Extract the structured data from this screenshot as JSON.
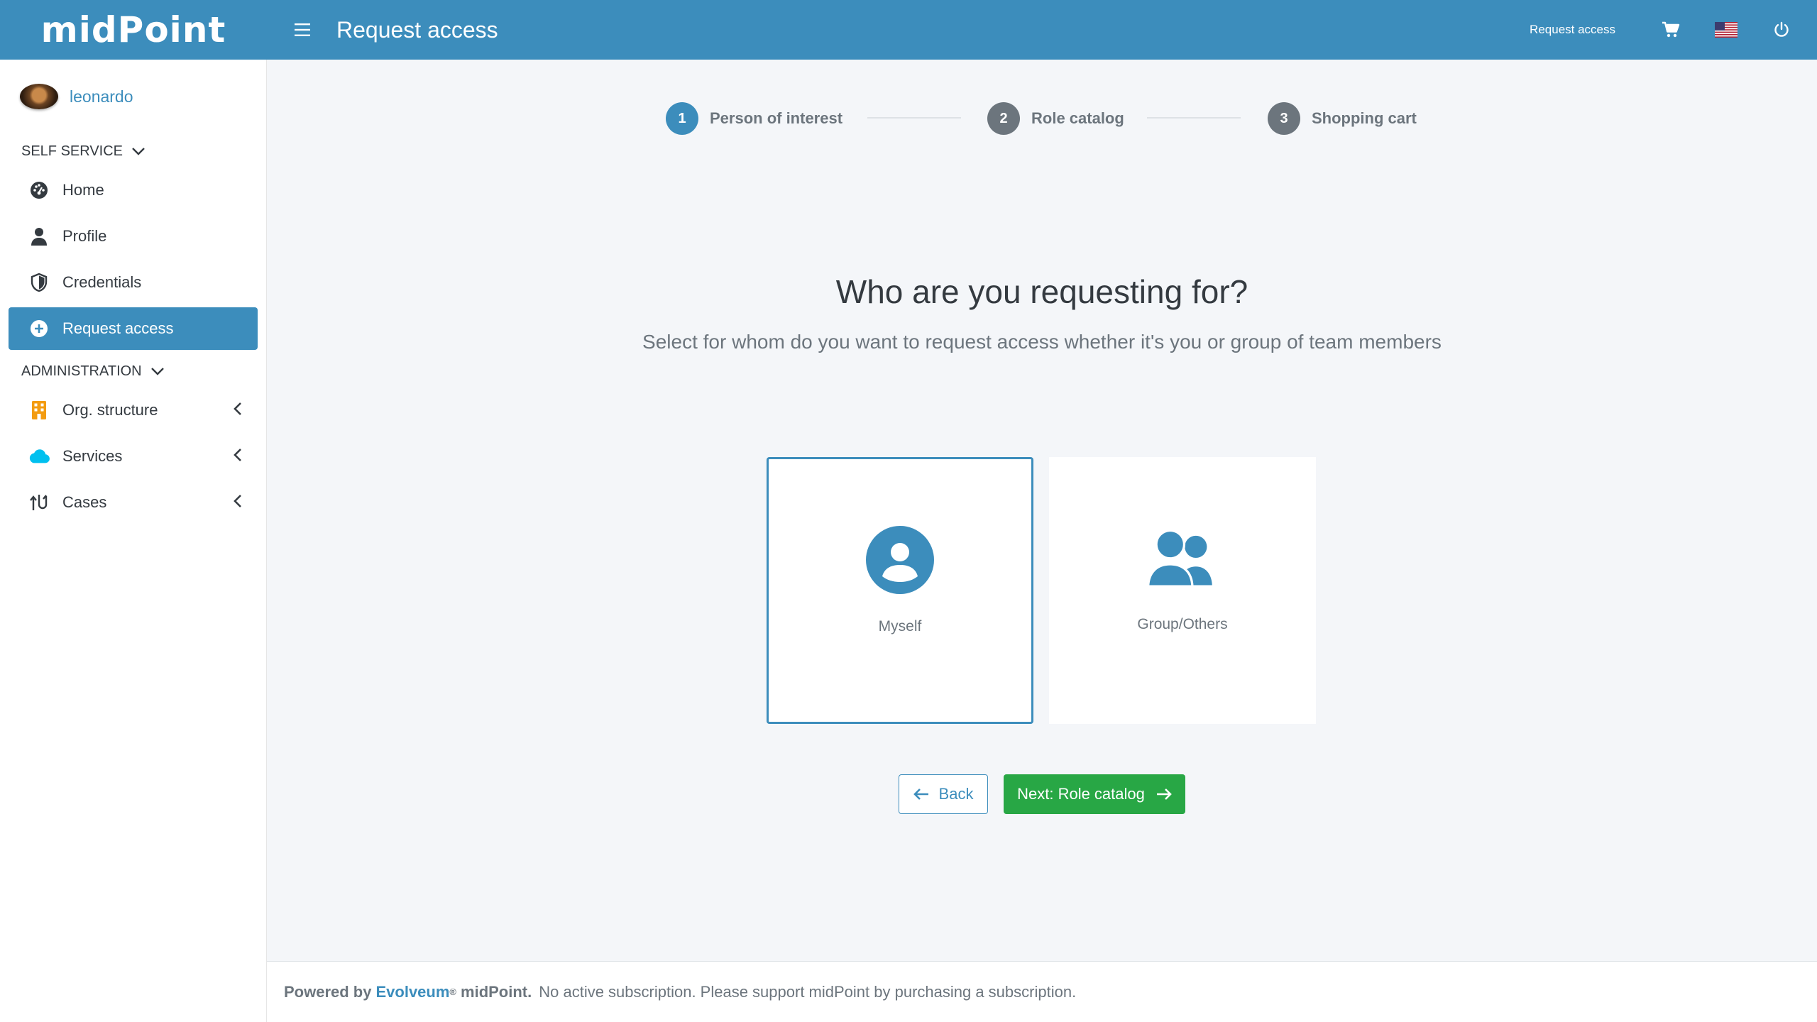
{
  "app": {
    "logo_text": "midPoint",
    "page_heading": "Request access"
  },
  "topbar": {
    "request_access_link": "Request access",
    "icons": [
      "hamburger-icon",
      "cart-icon",
      "us-flag-icon",
      "power-icon"
    ]
  },
  "sidebar": {
    "username": "leonardo",
    "sections": [
      {
        "title": "SELF SERVICE",
        "items": [
          {
            "label": "Home",
            "icon": "dashboard-icon"
          },
          {
            "label": "Profile",
            "icon": "user-icon"
          },
          {
            "label": "Credentials",
            "icon": "shield-icon"
          },
          {
            "label": "Request access",
            "icon": "plus-circle-icon",
            "active": true
          }
        ]
      },
      {
        "title": "ADMINISTRATION",
        "items": [
          {
            "label": "Org. structure",
            "icon": "building-icon",
            "icon_color": "#f39c12"
          },
          {
            "label": "Services",
            "icon": "cloud-icon",
            "icon_color": "#00c0ef"
          },
          {
            "label": "Cases",
            "icon": "cases-icon"
          }
        ]
      }
    ]
  },
  "wizard": {
    "steps": [
      {
        "number": "1",
        "label": "Person of interest",
        "active": true
      },
      {
        "number": "2",
        "label": "Role catalog",
        "active": false
      },
      {
        "number": "3",
        "label": "Shopping cart",
        "active": false
      }
    ],
    "title": "Who are you requesting for?",
    "subtitle": "Select for whom do you want to request access whether it's you or group of team members",
    "options": [
      {
        "label": "Myself",
        "icon": "user-circle-icon",
        "selected": true
      },
      {
        "label": "Group/Others",
        "icon": "users-icon",
        "selected": false
      }
    ],
    "back_label": "Back",
    "next_label": "Next: Role catalog"
  },
  "footer": {
    "powered_by": "Powered by",
    "brand": "Evolveum",
    "registered": "®",
    "product": "midPoint.",
    "notice": "No active subscription. Please support midPoint by purchasing a subscription."
  },
  "colors": {
    "primary": "#3c8dbc",
    "success": "#28a745",
    "muted": "#6c757d",
    "org_icon": "#f39c12",
    "services_icon": "#00c0ef"
  }
}
